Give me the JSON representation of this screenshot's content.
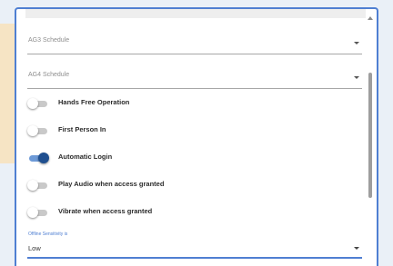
{
  "schedules": [
    {
      "label": "AG3 Schedule"
    },
    {
      "label": "AG4 Schedule"
    }
  ],
  "toggles": [
    {
      "label": "Hands Free Operation",
      "on": false
    },
    {
      "label": "First Person In",
      "on": false
    },
    {
      "label": "Automatic Login",
      "on": true
    },
    {
      "label": "Play Audio when access granted",
      "on": false
    },
    {
      "label": "Vibrate when access granted",
      "on": false
    }
  ],
  "offline_sensitivity": {
    "label": "Offline Sensitivity is",
    "value": "Low"
  },
  "colors": {
    "accent": "#4f7fd2",
    "toggle_on": "#1f4f8f",
    "side_panel": "#f6e4c4"
  }
}
